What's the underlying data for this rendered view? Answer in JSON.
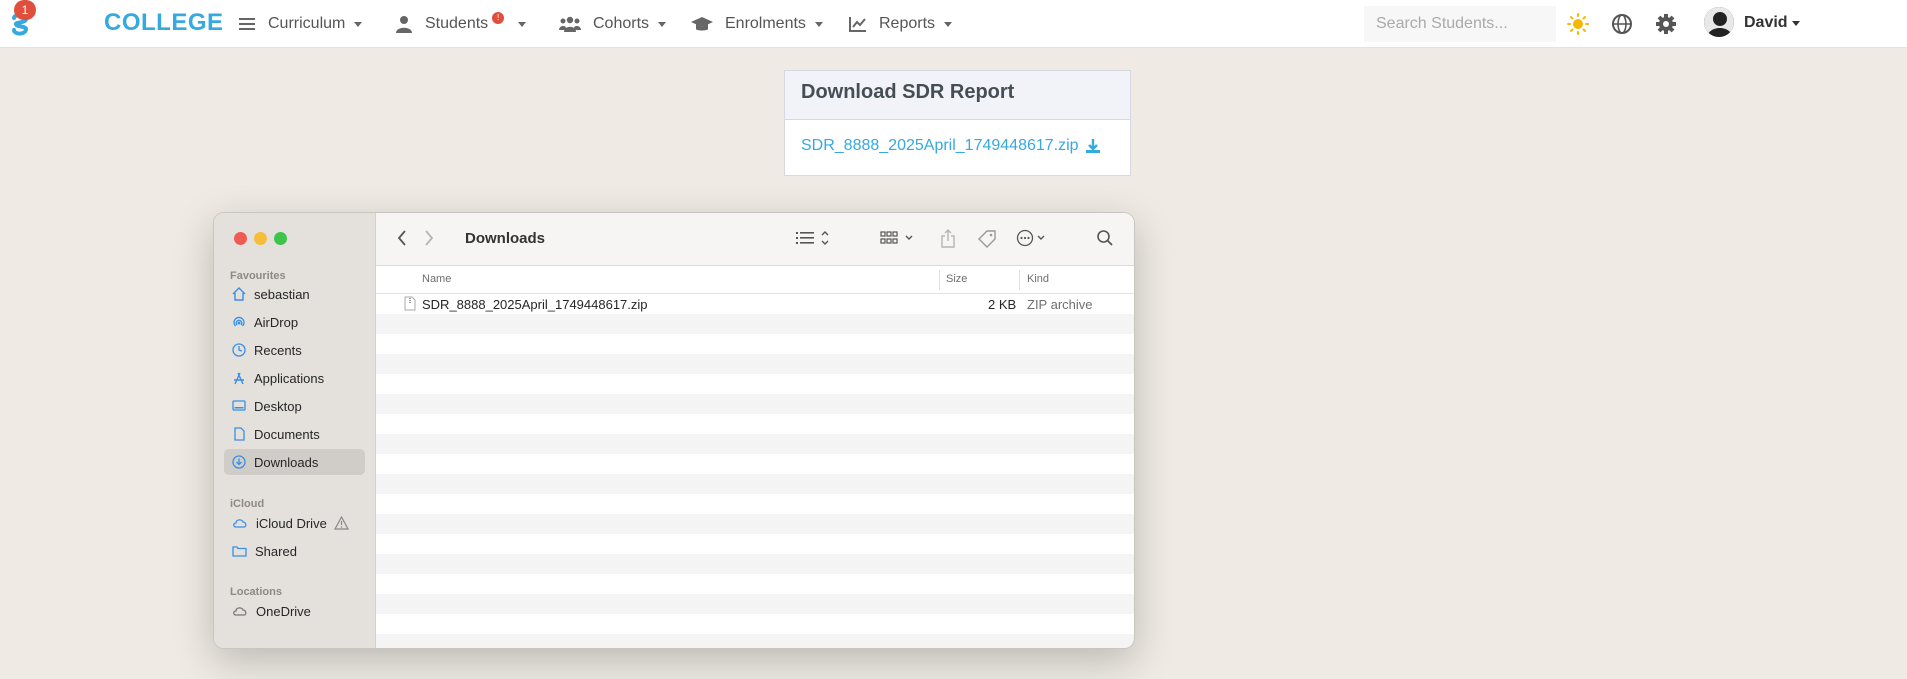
{
  "nav": {
    "logo_badge": "1",
    "brand": "COLLEGE",
    "items": [
      {
        "label": "Curriculum"
      },
      {
        "label": "Students",
        "badge": "!"
      },
      {
        "label": "Cohorts"
      },
      {
        "label": "Enrolments"
      },
      {
        "label": "Reports"
      }
    ],
    "search_placeholder": "Search Students...",
    "user": "David",
    "accent": "#36a9e1"
  },
  "card": {
    "title": "Download SDR Report",
    "link": "SDR_8888_2025April_1749448617.zip"
  },
  "finder": {
    "title": "Downloads",
    "sections": {
      "favourites": "Favourites",
      "icloud": "iCloud",
      "locations": "Locations"
    },
    "favourites": [
      "sebastian",
      "AirDrop",
      "Recents",
      "Applications",
      "Desktop",
      "Documents",
      "Downloads"
    ],
    "icloud": [
      "iCloud Drive",
      "Shared"
    ],
    "locations": [
      "OneDrive"
    ],
    "columns": {
      "name": "Name",
      "size": "Size",
      "kind": "Kind"
    },
    "files": [
      {
        "name": "SDR_8888_2025April_1749448617.zip",
        "size": "2 KB",
        "kind": "ZIP archive"
      }
    ]
  }
}
